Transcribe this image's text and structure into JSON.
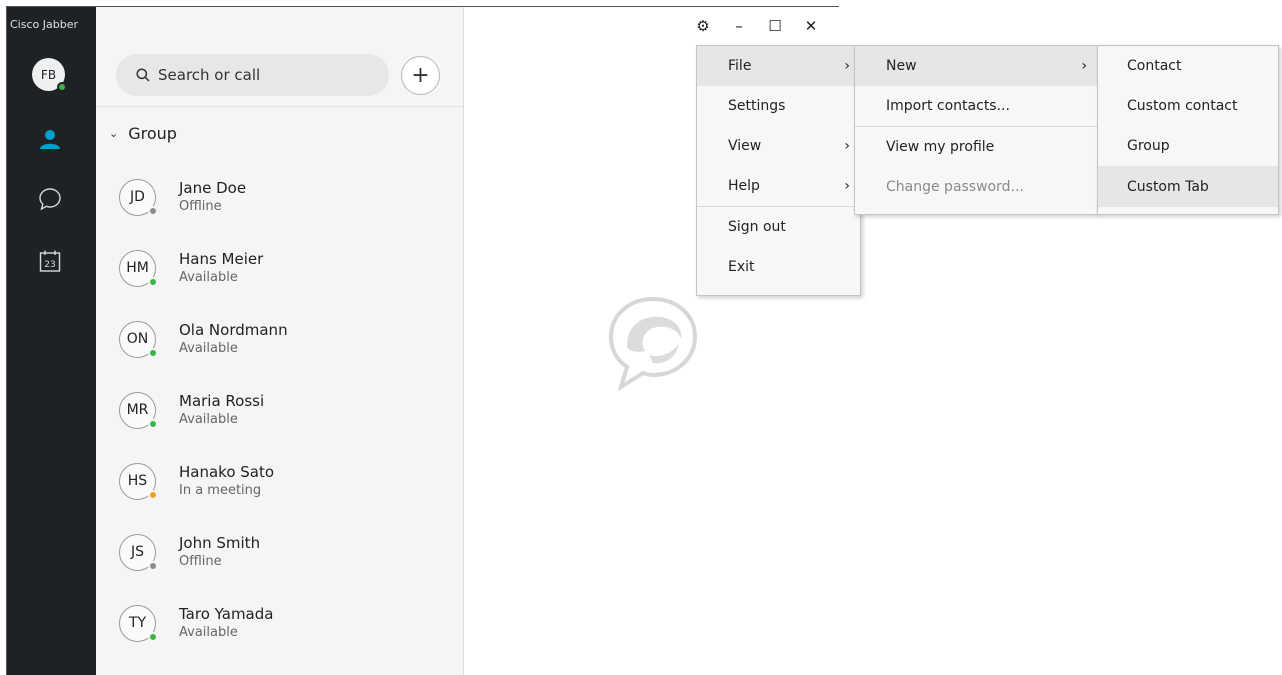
{
  "app": {
    "title": "Cisco Jabber",
    "user_initials": "FB",
    "user_status_color": "#3cb24a",
    "accent_color": "#00a0d1"
  },
  "rail": {
    "icons": [
      "contacts-icon",
      "chat-icon",
      "calendar-icon"
    ],
    "calendar_day": "23"
  },
  "search": {
    "placeholder": "Search or call",
    "value": ""
  },
  "add_button": {
    "label": "+"
  },
  "group": {
    "name": "Group"
  },
  "contacts": [
    {
      "initials": "JD",
      "name": "Jane Doe",
      "status": "Offline",
      "status_color": "#8c8c8c"
    },
    {
      "initials": "HM",
      "name": "Hans Meier",
      "status": "Available",
      "status_color": "#3cb24a"
    },
    {
      "initials": "ON",
      "name": "Ola Nordmann",
      "status": "Available",
      "status_color": "#3cb24a"
    },
    {
      "initials": "MR",
      "name": "Maria Rossi",
      "status": "Available",
      "status_color": "#3cb24a"
    },
    {
      "initials": "HS",
      "name": "Hanako Sato",
      "status": "In a meeting",
      "status_color": "#f0a12a"
    },
    {
      "initials": "JS",
      "name": "John Smith",
      "status": "Offline",
      "status_color": "#8c8c8c"
    },
    {
      "initials": "TY",
      "name": "Taro Yamada",
      "status": "Available",
      "status_color": "#3cb24a"
    }
  ],
  "window_controls": {
    "settings": "⚙",
    "minimize": "–",
    "maximize": "☐",
    "close": "✕"
  },
  "menu_main": {
    "items": [
      {
        "label": "File",
        "has_submenu": true
      },
      {
        "label": "Settings",
        "has_submenu": false
      },
      {
        "label": "View",
        "has_submenu": true
      },
      {
        "label": "Help",
        "has_submenu": true
      },
      {
        "label": "Sign out",
        "has_submenu": false
      },
      {
        "label": "Exit",
        "has_submenu": false
      }
    ]
  },
  "menu_file": {
    "items": [
      {
        "label": "New",
        "has_submenu": true
      },
      {
        "label": "Import contacts...",
        "has_submenu": false
      },
      {
        "label": "View my profile",
        "has_submenu": false
      },
      {
        "label": "Change password...",
        "has_submenu": false,
        "disabled": true
      }
    ]
  },
  "menu_new": {
    "items": [
      {
        "label": "Contact"
      },
      {
        "label": "Custom contact"
      },
      {
        "label": "Group"
      },
      {
        "label": "Custom Tab"
      }
    ]
  },
  "submenu_arrow": "›"
}
